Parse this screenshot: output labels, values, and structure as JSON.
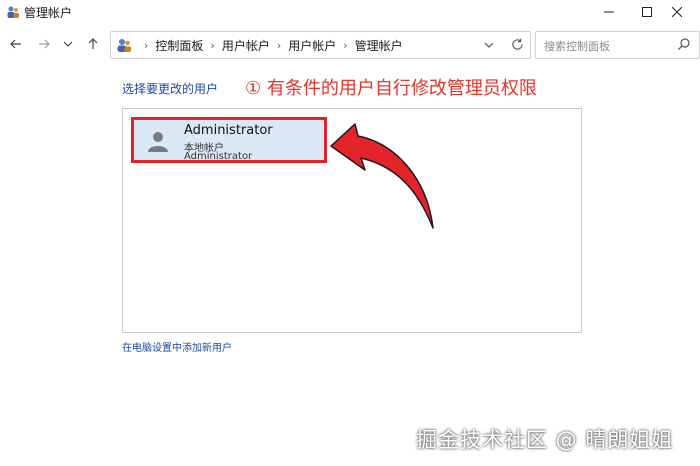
{
  "window": {
    "title": "管理帐户",
    "controls": [
      "minimize",
      "maximize",
      "close"
    ]
  },
  "navigation": {
    "breadcrumbs": [
      "控制面板",
      "用户帐户",
      "用户帐户",
      "管理帐户"
    ],
    "search_placeholder": "搜索控制面板"
  },
  "main": {
    "heading": "选择要更改的用户",
    "annotation": "① 有条件的用户自行修改管理员权限",
    "users": [
      {
        "name": "Administrator",
        "type": "本地帐户",
        "group": "Administrator"
      }
    ],
    "add_user_link": "在电脑设置中添加新用户"
  },
  "watermark": "掘金技术社区 @ 晴朗姐姐",
  "colors": {
    "link": "#1c4aa3",
    "annotation": "#e8332a",
    "highlight_border": "#e3242b",
    "selected_bg": "#dbe9f6"
  }
}
